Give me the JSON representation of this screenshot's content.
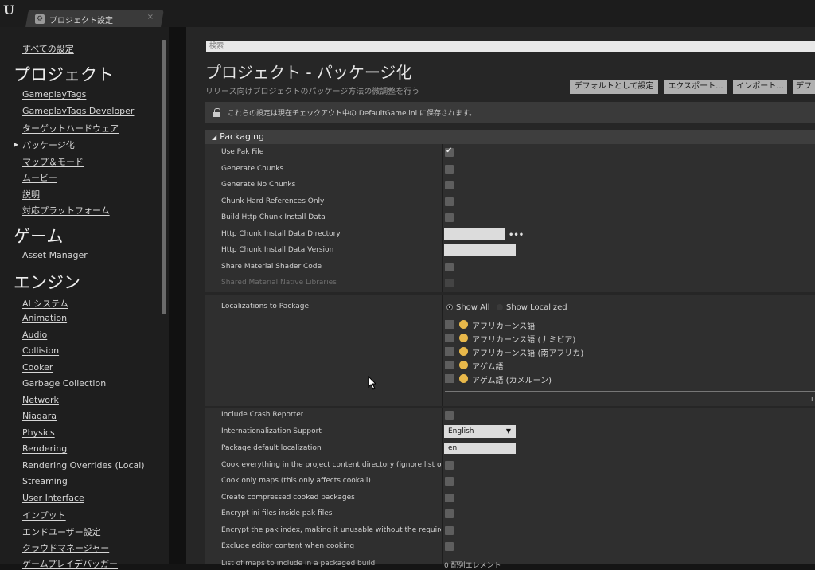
{
  "window": {
    "tab_title": "プロジェクト設定",
    "tab_close": "×"
  },
  "sidebar": {
    "all_settings": "すべての設定",
    "sections": [
      {
        "title": "プロジェクト",
        "items": [
          "GameplayTags",
          "GameplayTags Developer",
          "ターゲットハードウェア",
          "パッケージ化",
          "マップ＆モード",
          "ムービー",
          "説明",
          "対応プラットフォーム"
        ]
      },
      {
        "title": "ゲーム",
        "items": [
          "Asset Manager"
        ]
      },
      {
        "title": "エンジン",
        "items": [
          "AI システム",
          "Animation",
          "Audio",
          "Collision",
          "Cooker",
          "Garbage Collection",
          "Network",
          "Niagara",
          "Physics",
          "Rendering",
          "Rendering Overrides (Local)",
          "Streaming",
          "User Interface",
          "インプット",
          "エンドユーザー設定",
          "クラウドマネージャー",
          "ゲームプレイデバッガー"
        ]
      }
    ],
    "selected": "パッケージ化"
  },
  "main": {
    "search_placeholder": "検索",
    "title": "プロジェクト - パッケージ化",
    "subtitle": "リリース向けプロジェクトのパッケージ方法の微調整を行う",
    "buttons": [
      "デフォルトとして設定",
      "エクスポート...",
      "インポート...",
      "デフ"
    ],
    "notice": "これらの設定は現在チェックアウト中の DefaultGame.ini に保存されます。",
    "category": "Packaging",
    "properties_top": [
      {
        "label": "Use Pak File",
        "type": "checkbox",
        "checked": true
      },
      {
        "label": "Generate Chunks",
        "type": "checkbox",
        "checked": false
      },
      {
        "label": "Generate No Chunks",
        "type": "checkbox",
        "checked": false
      },
      {
        "label": "Chunk Hard References Only",
        "type": "checkbox",
        "checked": false
      },
      {
        "label": "Build Http Chunk Install Data",
        "type": "checkbox",
        "checked": false
      },
      {
        "label": "Http Chunk Install Data Directory",
        "type": "path",
        "value": ""
      },
      {
        "label": "Http Chunk Install Data Version",
        "type": "text",
        "value": ""
      },
      {
        "label": "Share Material Shader Code",
        "type": "checkbox",
        "checked": false
      },
      {
        "label": "Shared Material Native Libraries",
        "type": "checkbox",
        "checked": false,
        "disabled": true
      }
    ],
    "localizations": {
      "label": "Localizations to Package",
      "show_all": "Show All",
      "show_localized": "Show Localized",
      "items": [
        "アフリカーンス語",
        "アフリカーンス語 (ナミビア)",
        "アフリカーンス語 (南アフリカ)",
        "アゲム語",
        "アゲム語 (カメルーン)"
      ],
      "scroll_marker": "i"
    },
    "properties_bottom": [
      {
        "label": "Include Crash Reporter",
        "type": "checkbox"
      },
      {
        "label": "Internationalization Support",
        "type": "dropdown",
        "value": "English"
      },
      {
        "label": "Package default localization",
        "type": "text",
        "value": "en"
      },
      {
        "label": "Cook everything in the project content directory (ignore list of m",
        "type": "checkbox"
      },
      {
        "label": "Cook only maps (this only affects cookall)",
        "type": "checkbox"
      },
      {
        "label": "Create compressed cooked packages",
        "type": "checkbox"
      },
      {
        "label": "Encrypt ini files inside pak files",
        "type": "checkbox"
      },
      {
        "label": "Encrypt the pak index, making it unusable without the required ke",
        "type": "checkbox"
      },
      {
        "label": "Exclude editor content when cooking",
        "type": "checkbox"
      }
    ],
    "truncated_row": {
      "label": "List of maps to include in a packaged build",
      "value": "0 配列エレメント"
    }
  },
  "icons": {
    "ue_logo": "unreal-logo-icon",
    "lock": "lock-icon",
    "more": "ellipsis-icon"
  }
}
